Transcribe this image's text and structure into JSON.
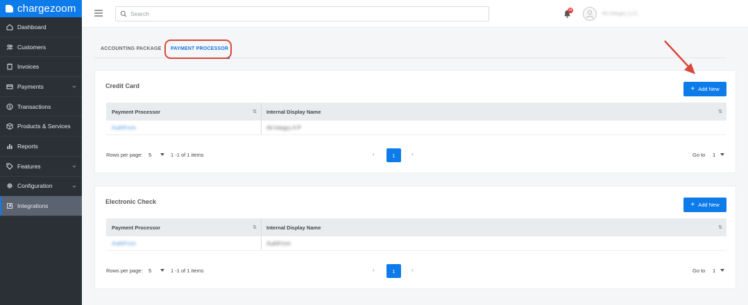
{
  "app": {
    "brand": "chargezoom"
  },
  "sidebar": {
    "items": [
      {
        "label": "Dashboard",
        "icon": "home-icon"
      },
      {
        "label": "Customers",
        "icon": "users-icon"
      },
      {
        "label": "Invoices",
        "icon": "clipboard-icon"
      },
      {
        "label": "Payments",
        "icon": "card-icon"
      },
      {
        "label": "Transactions",
        "icon": "dollar-icon"
      },
      {
        "label": "Products & Services",
        "icon": "box-icon"
      },
      {
        "label": "Reports",
        "icon": "bar-chart-icon"
      },
      {
        "label": "Features",
        "icon": "tag-icon"
      },
      {
        "label": "Configuration",
        "icon": "gear-icon"
      },
      {
        "label": "Integrations",
        "icon": "plug-icon"
      }
    ],
    "active_index": 9
  },
  "topbar": {
    "search_placeholder": "Search",
    "notification_count": "34",
    "username": "Ali Integry LLC"
  },
  "tabs": [
    {
      "label": "ACCOUNTING PACKAGE"
    },
    {
      "label": "PAYMENT PROCESSOR",
      "active": true
    }
  ],
  "credit_card": {
    "title": "Credit Card",
    "add_label": "Add New",
    "columns": [
      "Payment Processor",
      "Internal Display Name"
    ],
    "rows": [
      {
        "processor": "AuthFrcm",
        "display_name": "Ali Integry A P"
      }
    ],
    "rows_per_page_label": "Rows per page:",
    "rows_per_page": "5",
    "range": "1 -1 of 1 items",
    "current_page": "1",
    "goto_label": "Go to",
    "goto_value": "1"
  },
  "electronic_check": {
    "title": "Electronic Check",
    "add_label": "Add New",
    "columns": [
      "Payment Processor",
      "Internal Display Name"
    ],
    "rows": [
      {
        "processor": "AuthFrcm",
        "display_name": "AuthFrcm"
      }
    ],
    "rows_per_page_label": "Rows per page:",
    "rows_per_page": "5",
    "range": "1 -1 of 1 items",
    "current_page": "1",
    "goto_label": "Go to",
    "goto_value": "1"
  },
  "colors": {
    "accent": "#0d7bea",
    "sidebar_bg": "#2b3036",
    "annotation_red": "#d9483b"
  }
}
